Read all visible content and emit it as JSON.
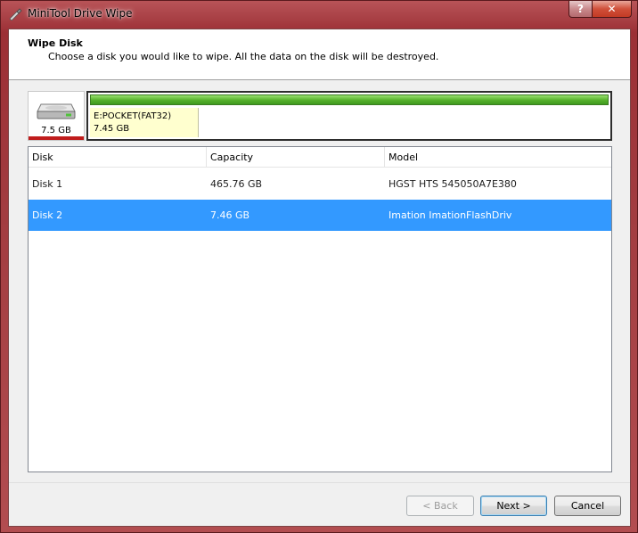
{
  "window": {
    "title": "MiniTool Drive Wipe",
    "help_label": "?",
    "close_label": "✕"
  },
  "header": {
    "title": "Wipe Disk",
    "description": "Choose a disk you would like to wipe. All the data on the disk will be destroyed."
  },
  "disk_map": {
    "disk_size": "7.5 GB",
    "partition": {
      "name": "E:POCKET(FAT32)",
      "size": "7.45 GB"
    }
  },
  "table": {
    "columns": [
      "Disk",
      "Capacity",
      "Model"
    ],
    "rows": [
      {
        "disk": "Disk 1",
        "capacity": "465.76 GB",
        "model": "HGST HTS 545050A7E380"
      },
      {
        "disk": "Disk 2",
        "capacity": "7.46 GB",
        "model": "Imation ImationFlashDriv"
      }
    ],
    "selected_index": 1
  },
  "buttons": {
    "back": "< Back",
    "next": "Next >",
    "cancel": "Cancel"
  },
  "colors": {
    "selection": "#3399ff",
    "partition_bar": "#55b02b",
    "partition_cell": "#ffffcf",
    "disk_underline": "#c01c1c"
  },
  "icons": {
    "app": "wipe-app-icon",
    "disk": "hard-drive-icon"
  }
}
